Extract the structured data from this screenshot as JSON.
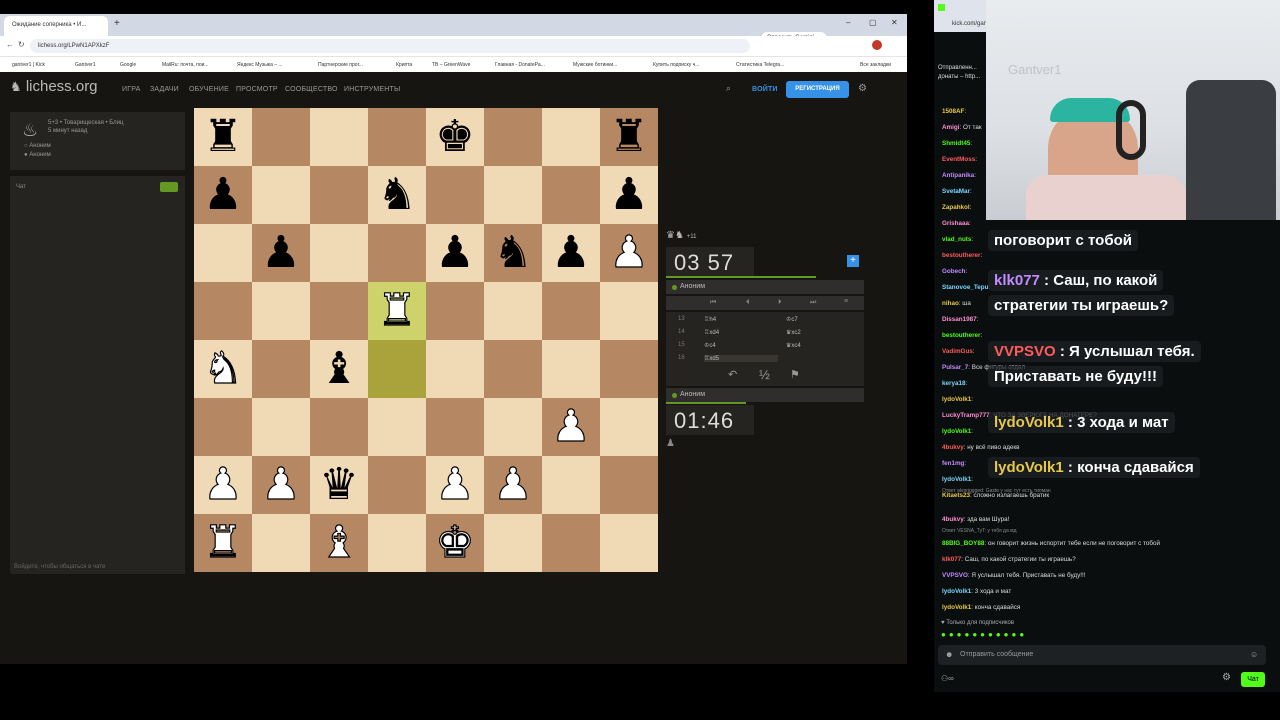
{
  "browser": {
    "tab_title": "Ожидание соперника • И...",
    "new_tab": "+",
    "gemini": "Спросить Gemini",
    "url": "lichess.org/LPwN1APXkzF",
    "bookmarks": [
      "gantver1 | Kick",
      "Gantver1",
      "Google",
      "MailRu: почта, пои...",
      "Яндекс Музыка – ...",
      "Партнерские прог...",
      "Крипта",
      "ТВ – GreenWave",
      "Главная - DonatePa...",
      "Мужские ботинки...",
      "Купить подписку ч...",
      "Статистика Telegra...",
      "Все закладки"
    ]
  },
  "lichess": {
    "logo": "lichess.org",
    "nav": [
      "ИГРА",
      "ЗАДАЧИ",
      "ОБУЧЕНИЕ",
      "ПРОСМОТР",
      "СООБЩЕСТВО",
      "ИНСТРУМЕНТЫ"
    ],
    "login": "ВОЙТИ",
    "register": "РЕГИСТРАЦИЯ",
    "game_type": "5+3 • Товарищеская • Блиц",
    "game_time": "5 минут назад",
    "players": [
      "Аноним",
      "Аноним"
    ],
    "chat_label": "Чат",
    "chat_hint": "Войдите, чтобы общаться в чате",
    "clock_top": "03 57",
    "clock_bottom": "01:46",
    "player_top": "Аноним",
    "player_bottom": "Аноним",
    "material": "+11",
    "moves": [
      {
        "n": "13",
        "w": "♖h4",
        "b": "♔c7"
      },
      {
        "n": "14",
        "w": "♖xd4",
        "b": "♛xc2"
      },
      {
        "n": "15",
        "w": "♔c4",
        "b": "♛xc4"
      },
      {
        "n": "16",
        "w": "♖xd5",
        "b": ""
      }
    ],
    "draw": "½"
  },
  "board": [
    [
      "bR",
      "",
      "",
      "",
      "bK",
      "",
      "",
      "bR"
    ],
    [
      "bP",
      "",
      "",
      "bN",
      "",
      "",
      "",
      "bP"
    ],
    [
      "",
      "bP",
      "",
      "",
      "bP",
      "bN",
      "bP",
      "wP"
    ],
    [
      "",
      "",
      "",
      "wR",
      "",
      "",
      "",
      ""
    ],
    [
      "wN",
      "",
      "bB",
      "",
      "",
      "",
      "",
      ""
    ],
    [
      "",
      "",
      "",
      "",
      "",
      "",
      "wP",
      ""
    ],
    [
      "wP",
      "wP",
      "bQ",
      "",
      "wP",
      "wP",
      "",
      ""
    ],
    [
      "wR",
      "",
      "wB",
      "",
      "wK",
      "",
      "",
      ""
    ]
  ],
  "kick": {
    "url": "kick.com/gantver1",
    "pinned": "Отправленн... донаты – http...",
    "chat": [
      {
        "user": "1508AF",
        "text": ""
      },
      {
        "user": "Amigi",
        "text": "От так"
      },
      {
        "user": "Shmidt45",
        "text": ""
      },
      {
        "user": "EventMoss",
        "text": ""
      },
      {
        "user": "Antipanika",
        "text": ""
      },
      {
        "user": "SvetaMar",
        "text": ""
      },
      {
        "user": "Zapahkol",
        "text": ""
      },
      {
        "user": "Grishaaa",
        "text": ""
      },
      {
        "user": "vlad_nuts",
        "text": ""
      },
      {
        "user": "bestoutherer",
        "text": ""
      },
      {
        "user": "Gobech",
        "text": ""
      },
      {
        "user": "Stanovoe_Tepu",
        "text": ""
      },
      {
        "user": "nihao",
        "text": "ша"
      },
      {
        "user": "Dissan1987",
        "text": ""
      },
      {
        "user": "bestoutherer",
        "text": ""
      },
      {
        "user": "VadimGus",
        "text": ""
      },
      {
        "user": "Pulsar_7",
        "text": "Все фигуры отдал"
      },
      {
        "user": "kerya18",
        "text": ""
      },
      {
        "user": "lydoVolk1",
        "text": ""
      },
      {
        "user": "LuckyTramp777",
        "text": "ЧТО ЗА ЗВЕРЮГА НА ДОНАТЕРЕ?"
      },
      {
        "user": "lydoVolk1",
        "text": ""
      },
      {
        "user": "4bukvy",
        "text": "ну всё пиво адекв"
      },
      {
        "user": "fen1mg",
        "text": ""
      },
      {
        "user": "lydoVolk1",
        "text": ""
      },
      {
        "user": "Kitaets23",
        "text": "сложно излагаешь братик"
      },
      {
        "user": "4bukvy",
        "text": "зда вам Шура!"
      },
      {
        "user": "88BIG_BOY88",
        "text": "он говорит жизнь испортит тебе если не поговорит с тобой"
      },
      {
        "user": "klk077",
        "text": "Саш, по какой стратегии ты играешь?"
      },
      {
        "user": "VVPSVO",
        "text": "Я услышал тебя. Приставать не буду!!!"
      },
      {
        "user": "lydoVolk1",
        "text": "3 хода и мат"
      },
      {
        "user": "lydoVolk1",
        "text": "конча сдавайся"
      }
    ],
    "overlay": [
      {
        "user": "",
        "text": "поговорит с тобой"
      },
      {
        "user": "klk077",
        "text": "Саш, по какой"
      },
      {
        "user": "",
        "text": "стратегии ты играешь?"
      },
      {
        "user": "VVPSVO",
        "text": "Я услышал тебя."
      },
      {
        "user": "",
        "text": "Приставать не буду!!!"
      },
      {
        "user": "lydoVolk1",
        "text": "3 хода и мат"
      },
      {
        "user": "lydoVolk1",
        "text": "конча сдавайся"
      }
    ],
    "reply1": "Ответ alexriggged: Gaste у нас тут есть тиоман",
    "reply2": "Ответ VESNA_TyT: у тебя да мд",
    "subs_only": "Только для подписчиков",
    "send_placeholder": "Отправить сообщение",
    "chat_button": "Чат",
    "cam_text": "Gantver1"
  },
  "colors": {
    "accent": "#3692e7",
    "kick_green": "#53fc18",
    "highlight": "#cdd26a"
  }
}
